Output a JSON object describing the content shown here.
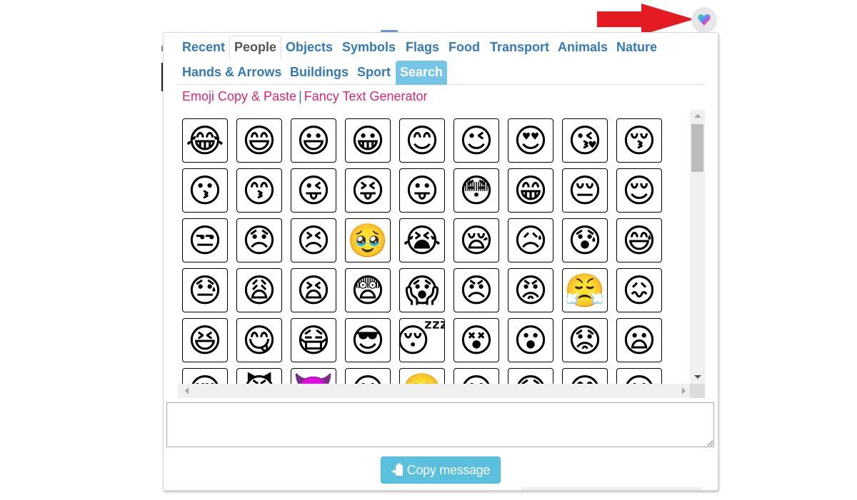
{
  "launcher": {
    "icon": "rainbow-heart-icon"
  },
  "annotation": {
    "icon": "red-arrow-icon",
    "color": "#e41b23"
  },
  "tabs": [
    {
      "label": "Recent",
      "active": false
    },
    {
      "label": "People",
      "active": true
    },
    {
      "label": "Objects",
      "active": false
    },
    {
      "label": "Symbols",
      "active": false
    },
    {
      "label": "Flags",
      "active": false
    },
    {
      "label": "Food",
      "active": false
    },
    {
      "label": "Transport",
      "active": false
    },
    {
      "label": "Animals",
      "active": false
    },
    {
      "label": "Nature",
      "active": false
    },
    {
      "label": "Hands & Arrows",
      "active": false
    },
    {
      "label": "Buildings",
      "active": false
    },
    {
      "label": "Sport",
      "active": false
    },
    {
      "label": "Search",
      "active": false,
      "highlight": true
    }
  ],
  "links": {
    "emoji_copy_paste": "Emoji Copy & Paste",
    "separator": "|",
    "fancy_text": "Fancy Text Generator"
  },
  "emojis": [
    "😂",
    "😄",
    "😃",
    "😀",
    "😊",
    "😉",
    "😍",
    "😘",
    "😚",
    "😗",
    "😙",
    "😜",
    "😝",
    "😛",
    "😳",
    "😁",
    "😔",
    "😌",
    "😒",
    "😞",
    "😣",
    "🥹",
    "😭",
    "😪",
    "😥",
    "😰",
    "😅",
    "😓",
    "😩",
    "😫",
    "😨",
    "😱",
    "😠",
    "😡",
    "😤",
    "😖",
    "😆",
    "😋",
    "😷",
    "😎",
    "😴",
    "😵",
    "😮",
    "😟",
    "😦",
    "😌",
    "😈",
    "👿",
    "😐",
    "😬",
    "😐",
    "😯",
    "😊",
    "😶"
  ],
  "message": {
    "value": "",
    "placeholder": ""
  },
  "copy_button": {
    "label": "Copy message",
    "icon": "clipboard-paste-icon"
  },
  "colors": {
    "tab_text": "#337ab7",
    "active_tab_text": "#555555",
    "search_tab_bg": "#76c5e6",
    "link_pink": "#e0256b",
    "button_bg": "#5bc0de"
  }
}
